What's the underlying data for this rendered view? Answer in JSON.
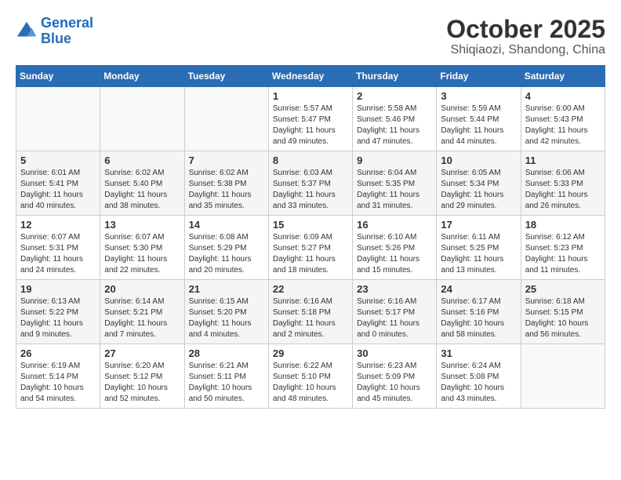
{
  "header": {
    "logo_line1": "General",
    "logo_line2": "Blue",
    "month": "October 2025",
    "location": "Shiqiaozi, Shandong, China"
  },
  "weekdays": [
    "Sunday",
    "Monday",
    "Tuesday",
    "Wednesday",
    "Thursday",
    "Friday",
    "Saturday"
  ],
  "weeks": [
    [
      {
        "day": "",
        "info": ""
      },
      {
        "day": "",
        "info": ""
      },
      {
        "day": "",
        "info": ""
      },
      {
        "day": "1",
        "info": "Sunrise: 5:57 AM\nSunset: 5:47 PM\nDaylight: 11 hours\nand 49 minutes."
      },
      {
        "day": "2",
        "info": "Sunrise: 5:58 AM\nSunset: 5:46 PM\nDaylight: 11 hours\nand 47 minutes."
      },
      {
        "day": "3",
        "info": "Sunrise: 5:59 AM\nSunset: 5:44 PM\nDaylight: 11 hours\nand 44 minutes."
      },
      {
        "day": "4",
        "info": "Sunrise: 6:00 AM\nSunset: 5:43 PM\nDaylight: 11 hours\nand 42 minutes."
      }
    ],
    [
      {
        "day": "5",
        "info": "Sunrise: 6:01 AM\nSunset: 5:41 PM\nDaylight: 11 hours\nand 40 minutes."
      },
      {
        "day": "6",
        "info": "Sunrise: 6:02 AM\nSunset: 5:40 PM\nDaylight: 11 hours\nand 38 minutes."
      },
      {
        "day": "7",
        "info": "Sunrise: 6:02 AM\nSunset: 5:38 PM\nDaylight: 11 hours\nand 35 minutes."
      },
      {
        "day": "8",
        "info": "Sunrise: 6:03 AM\nSunset: 5:37 PM\nDaylight: 11 hours\nand 33 minutes."
      },
      {
        "day": "9",
        "info": "Sunrise: 6:04 AM\nSunset: 5:35 PM\nDaylight: 11 hours\nand 31 minutes."
      },
      {
        "day": "10",
        "info": "Sunrise: 6:05 AM\nSunset: 5:34 PM\nDaylight: 11 hours\nand 29 minutes."
      },
      {
        "day": "11",
        "info": "Sunrise: 6:06 AM\nSunset: 5:33 PM\nDaylight: 11 hours\nand 26 minutes."
      }
    ],
    [
      {
        "day": "12",
        "info": "Sunrise: 6:07 AM\nSunset: 5:31 PM\nDaylight: 11 hours\nand 24 minutes."
      },
      {
        "day": "13",
        "info": "Sunrise: 6:07 AM\nSunset: 5:30 PM\nDaylight: 11 hours\nand 22 minutes."
      },
      {
        "day": "14",
        "info": "Sunrise: 6:08 AM\nSunset: 5:29 PM\nDaylight: 11 hours\nand 20 minutes."
      },
      {
        "day": "15",
        "info": "Sunrise: 6:09 AM\nSunset: 5:27 PM\nDaylight: 11 hours\nand 18 minutes."
      },
      {
        "day": "16",
        "info": "Sunrise: 6:10 AM\nSunset: 5:26 PM\nDaylight: 11 hours\nand 15 minutes."
      },
      {
        "day": "17",
        "info": "Sunrise: 6:11 AM\nSunset: 5:25 PM\nDaylight: 11 hours\nand 13 minutes."
      },
      {
        "day": "18",
        "info": "Sunrise: 6:12 AM\nSunset: 5:23 PM\nDaylight: 11 hours\nand 11 minutes."
      }
    ],
    [
      {
        "day": "19",
        "info": "Sunrise: 6:13 AM\nSunset: 5:22 PM\nDaylight: 11 hours\nand 9 minutes."
      },
      {
        "day": "20",
        "info": "Sunrise: 6:14 AM\nSunset: 5:21 PM\nDaylight: 11 hours\nand 7 minutes."
      },
      {
        "day": "21",
        "info": "Sunrise: 6:15 AM\nSunset: 5:20 PM\nDaylight: 11 hours\nand 4 minutes."
      },
      {
        "day": "22",
        "info": "Sunrise: 6:16 AM\nSunset: 5:18 PM\nDaylight: 11 hours\nand 2 minutes."
      },
      {
        "day": "23",
        "info": "Sunrise: 6:16 AM\nSunset: 5:17 PM\nDaylight: 11 hours\nand 0 minutes."
      },
      {
        "day": "24",
        "info": "Sunrise: 6:17 AM\nSunset: 5:16 PM\nDaylight: 10 hours\nand 58 minutes."
      },
      {
        "day": "25",
        "info": "Sunrise: 6:18 AM\nSunset: 5:15 PM\nDaylight: 10 hours\nand 56 minutes."
      }
    ],
    [
      {
        "day": "26",
        "info": "Sunrise: 6:19 AM\nSunset: 5:14 PM\nDaylight: 10 hours\nand 54 minutes."
      },
      {
        "day": "27",
        "info": "Sunrise: 6:20 AM\nSunset: 5:12 PM\nDaylight: 10 hours\nand 52 minutes."
      },
      {
        "day": "28",
        "info": "Sunrise: 6:21 AM\nSunset: 5:11 PM\nDaylight: 10 hours\nand 50 minutes."
      },
      {
        "day": "29",
        "info": "Sunrise: 6:22 AM\nSunset: 5:10 PM\nDaylight: 10 hours\nand 48 minutes."
      },
      {
        "day": "30",
        "info": "Sunrise: 6:23 AM\nSunset: 5:09 PM\nDaylight: 10 hours\nand 45 minutes."
      },
      {
        "day": "31",
        "info": "Sunrise: 6:24 AM\nSunset: 5:08 PM\nDaylight: 10 hours\nand 43 minutes."
      },
      {
        "day": "",
        "info": ""
      }
    ]
  ]
}
